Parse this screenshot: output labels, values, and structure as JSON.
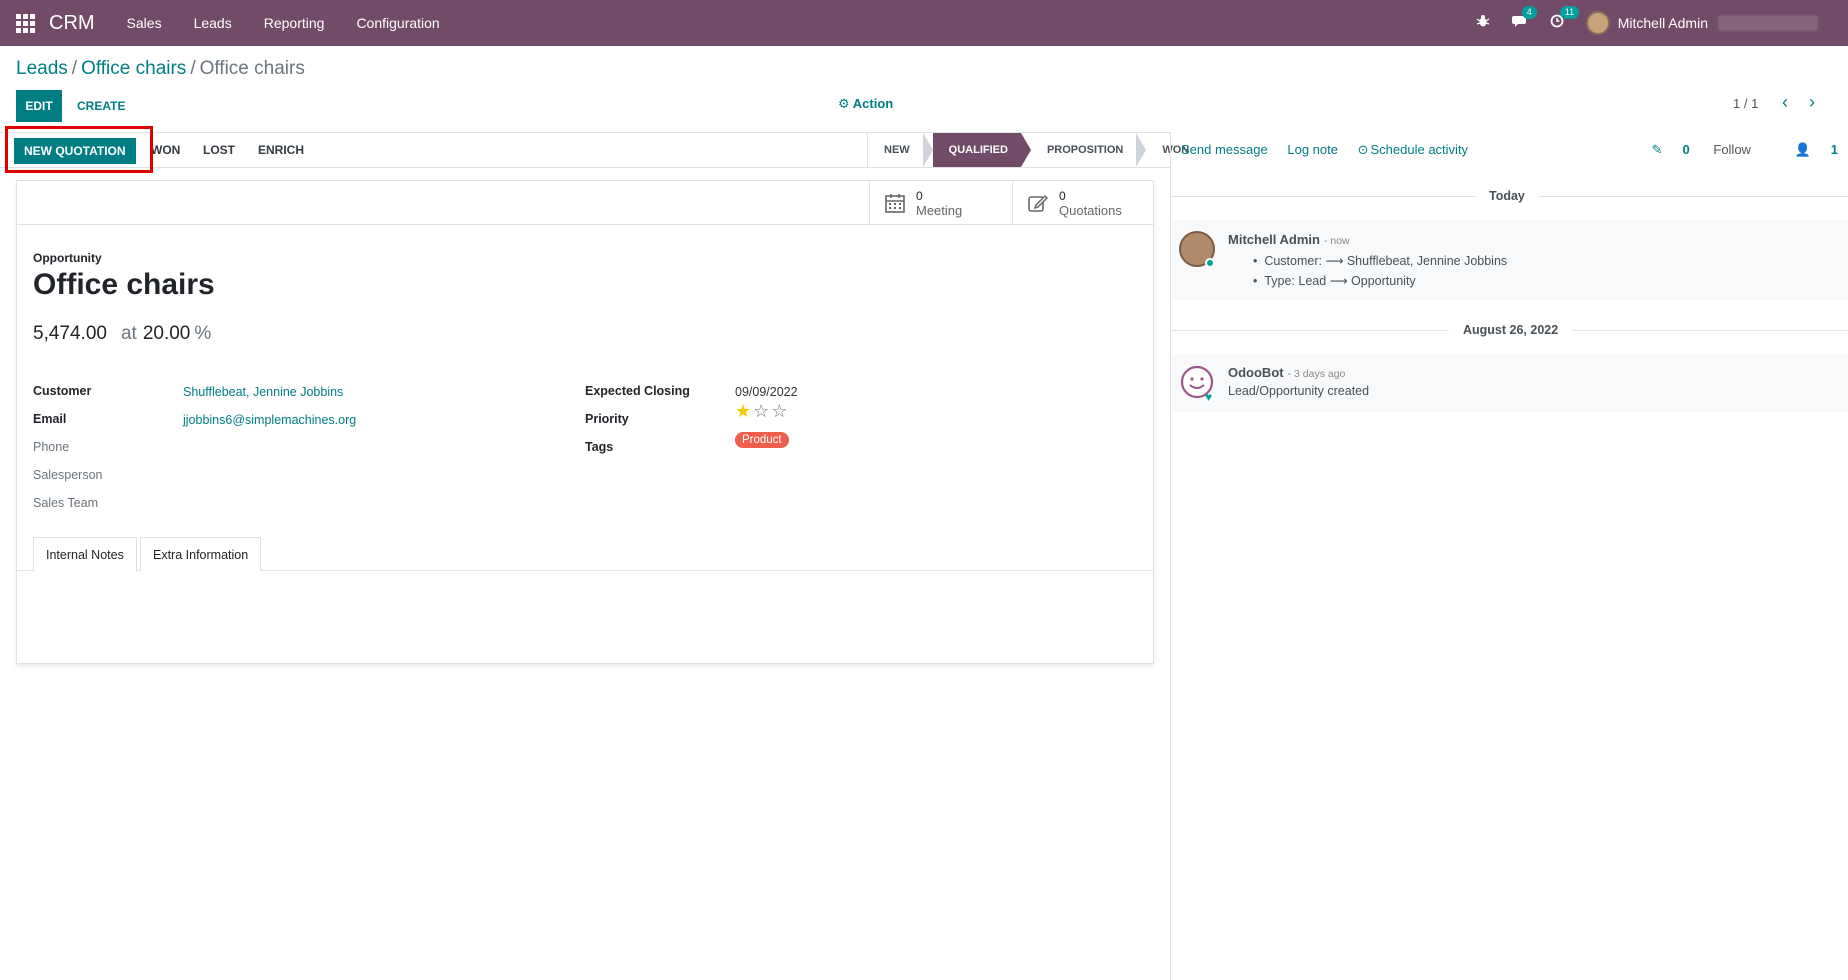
{
  "navbar": {
    "brand": "CRM",
    "menu": [
      "Sales",
      "Leads",
      "Reporting",
      "Configuration"
    ],
    "messages_badge": "4",
    "activities_badge": "11",
    "user_name": "Mitchell Admin"
  },
  "breadcrumb": {
    "items": [
      "Leads",
      "Office chairs"
    ],
    "current": "Office chairs"
  },
  "control": {
    "edit_label": "EDIT",
    "create_label": "CREATE",
    "action_label": "Action",
    "pager": "1 / 1"
  },
  "statusbar": {
    "buttons": [
      "NEW QUOTATION",
      "WON",
      "LOST",
      "ENRICH"
    ],
    "stages": [
      "NEW",
      "QUALIFIED",
      "PROPOSITION",
      "WON"
    ],
    "current_stage": "QUALIFIED"
  },
  "smart_buttons": [
    {
      "count": "0",
      "label": "Meeting",
      "icon": "calendar-icon"
    },
    {
      "count": "0",
      "label": "Quotations",
      "icon": "pencil-square-icon"
    }
  ],
  "form": {
    "type_label": "Opportunity",
    "title": "Office chairs",
    "revenue": "5,474.00",
    "at_label": "at",
    "probability": "20.00",
    "percent_sign": "%",
    "left_fields": [
      {
        "label": "Customer",
        "value": "Shufflebeat, Jennine Jobbins"
      },
      {
        "label": "Email",
        "value": "jjobbins6@simplemachines.org"
      },
      {
        "label": "Phone",
        "value": ""
      },
      {
        "label": "Salesperson",
        "value": ""
      },
      {
        "label": "Sales Team",
        "value": ""
      }
    ],
    "right_fields": [
      {
        "label": "Expected Closing",
        "value": "09/09/2022"
      },
      {
        "label": "Priority",
        "value": "1 of 3 stars"
      },
      {
        "label": "Tags",
        "value": "Product"
      }
    ],
    "priority_stars": 1,
    "tabs": [
      "Internal Notes",
      "Extra Information"
    ]
  },
  "chatter": {
    "send_message": "Send message",
    "log_note": "Log note",
    "schedule_activity": "Schedule activity",
    "attachments": "0",
    "follow": "Follow",
    "followers": "1",
    "groups": [
      {
        "date": "Today",
        "messages": [
          {
            "author": "Mitchell Admin",
            "time": "- now",
            "lines": [
              "Customer: ⟶ Shufflebeat, Jennine Jobbins",
              "Type: Lead ⟶ Opportunity"
            ]
          }
        ]
      },
      {
        "date": "August 26, 2022",
        "messages": [
          {
            "author": "OdooBot",
            "time": "- 3 days ago",
            "lines": [
              "Lead/Opportunity created"
            ]
          }
        ]
      }
    ]
  },
  "colors": {
    "brand": "#714b67",
    "accent": "#017e84",
    "tag": "#ee5e4b",
    "highlight": "#e00000"
  }
}
